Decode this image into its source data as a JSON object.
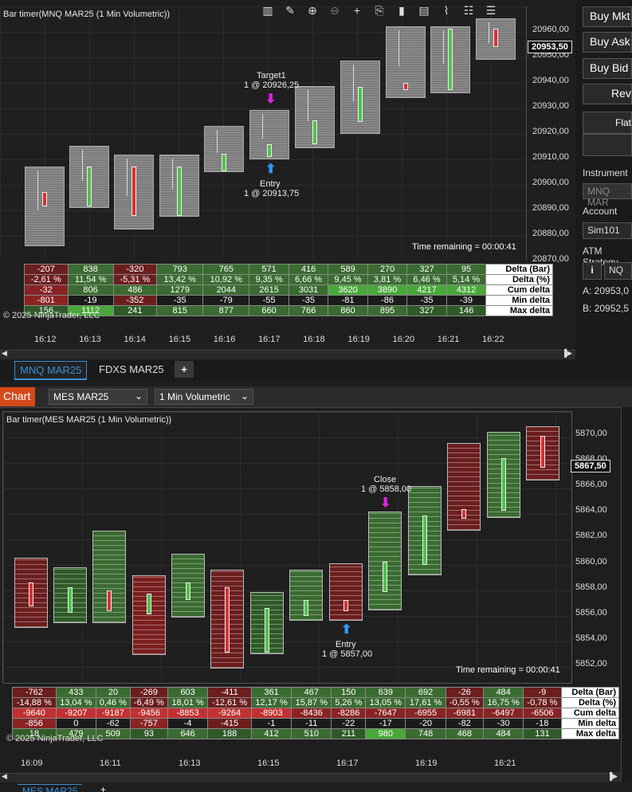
{
  "top_chart": {
    "title": "Bar timer(MNQ MAR25 (1 Min Volumetric))",
    "price_ticks": [
      "20960,00",
      "20950,00",
      "20940,00",
      "20930,00",
      "20920,00",
      "20910,00",
      "20900,00",
      "20890,00",
      "20880,00",
      "20870,00"
    ],
    "current_price": "20953,50",
    "time_remaining": "Time remaining = 00:00:41",
    "copyright": "© 2025 NinjaTrader, LLC",
    "times": [
      "16:12",
      "16:13",
      "16:14",
      "16:15",
      "16:16",
      "16:17",
      "16:18",
      "16:19",
      "16:20",
      "16:21",
      "16:22"
    ],
    "target_label": "Target1",
    "target_fill": "1 @ 20926,25",
    "entry_label": "Entry",
    "entry_fill": "1 @ 20913,75",
    "stats": {
      "row_labels": [
        "Delta (Bar)",
        "Delta (%)",
        "Cum delta",
        "Min delta",
        "Max delta"
      ],
      "delta_bar": [
        "-207",
        "838",
        "-320",
        "793",
        "765",
        "571",
        "416",
        "589",
        "270",
        "327",
        "95"
      ],
      "delta_pct": [
        "-2,61 %",
        "11,54 %",
        "-5,31 %",
        "13,42 %",
        "10,92 %",
        "9,35 %",
        "6,66 %",
        "9,45 %",
        "3,81 %",
        "6,46 %",
        "5,14 %"
      ],
      "cum_delta": [
        "-32",
        "806",
        "486",
        "1279",
        "2044",
        "2615",
        "3031",
        "3620",
        "3890",
        "4217",
        "4312"
      ],
      "min_delta": [
        "-801",
        "-19",
        "-352",
        "-35",
        "-79",
        "-55",
        "-35",
        "-81",
        "-86",
        "-35",
        "-39"
      ],
      "max_delta": [
        "156",
        "1112",
        "241",
        "815",
        "877",
        "660",
        "766",
        "860",
        "895",
        "327",
        "146"
      ]
    }
  },
  "tabs": {
    "tab1": "MNQ MAR25",
    "tab2": "FDXS MAR25",
    "add": "+",
    "bottom_tab1": "MES MAR25",
    "bottom_add": "+"
  },
  "toolbar": {
    "chart_label": "Chart",
    "instrument": "MES MAR25",
    "interval": "1 Min Volumetric"
  },
  "bottom_chart": {
    "title": "Bar timer(MES MAR25 (1 Min Volumetric))",
    "price_ticks": [
      "5870,00",
      "5868,00",
      "5866,00",
      "5864,00",
      "5862,00",
      "5860,00",
      "5858,00",
      "5856,00",
      "5854,00",
      "5852,00"
    ],
    "current_price": "5867,50",
    "time_remaining": "Time remaining = 00:00:41",
    "copyright": "© 2025 NinjaTrader, LLC",
    "times": [
      "16:09",
      "16:11",
      "16:13",
      "16:15",
      "16:17",
      "16:19",
      "16:21"
    ],
    "close_label": "Close",
    "close_fill": "1 @ 5858,00",
    "entry_label": "Entry",
    "entry_fill": "1 @ 5857,00",
    "stats": {
      "row_labels": [
        "Delta (Bar)",
        "Delta (%)",
        "Cum delta",
        "Min delta",
        "Max delta"
      ],
      "delta_bar": [
        "-762",
        "433",
        "20",
        "-269",
        "603",
        "-411",
        "361",
        "467",
        "150",
        "639",
        "692",
        "-26",
        "484",
        "-9"
      ],
      "delta_pct": [
        "-14,88 %",
        "13,04 %",
        "0,46 %",
        "-6,49 %",
        "18,01 %",
        "-12,61 %",
        "12,17 %",
        "15,87 %",
        "5,26 %",
        "13,05 %",
        "17,61 %",
        "-0,55 %",
        "16,75 %",
        "-0,78 %"
      ],
      "cum_delta": [
        "-9640",
        "-9207",
        "-9187",
        "-9456",
        "-8853",
        "-9264",
        "-8903",
        "-8436",
        "-8286",
        "-7647",
        "-6955",
        "-6981",
        "-6497",
        "-6506"
      ],
      "min_delta": [
        "-856",
        "0",
        "-62",
        "-757",
        "-4",
        "-415",
        "-1",
        "-11",
        "-22",
        "-17",
        "-20",
        "-82",
        "-30",
        "-18"
      ],
      "max_delta": [
        "18",
        "479",
        "509",
        "93",
        "646",
        "188",
        "412",
        "510",
        "211",
        "980",
        "748",
        "468",
        "484",
        "131"
      ]
    }
  },
  "side_panel": {
    "buy_market": "Buy Mkt",
    "buy_ask": "Buy Ask",
    "buy_bid": "Buy Bid",
    "reverse": "Rev",
    "flatten": "Flat",
    "instrument_label": "Instrument",
    "instrument_value": "MNQ MAR",
    "account_label": "Account",
    "account_value": "Sim101",
    "atm_label": "ATM Strategy",
    "atm_value": "NQ",
    "info_icon": "i",
    "ask_line": "A:  20953,0",
    "bid_line": "B:  20952,5"
  },
  "colors": {
    "bull": "#4fc24a",
    "bear": "#d93030",
    "target_arrow": "#e020e0",
    "entry_arrow": "#3399ff",
    "tab_active": "#3a8fd8",
    "chart_button": "#d44a1a"
  }
}
